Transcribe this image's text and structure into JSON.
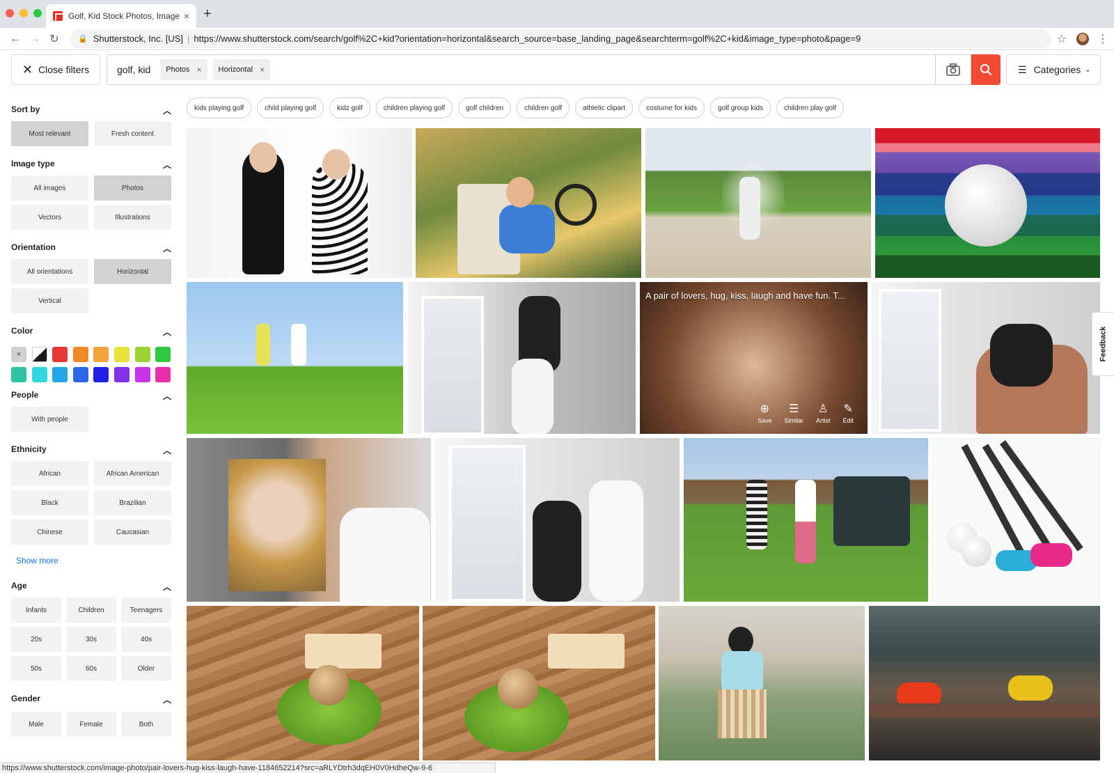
{
  "browser": {
    "tab_title": "Golf, Kid Stock Photos, Images",
    "tab_close": "×",
    "new_tab": "+",
    "org": "Shutterstock, Inc. [US]",
    "separator": "|",
    "url": "https://www.shutterstock.com/search/golf%2C+kid?orientation=horizontal&search_source=base_landing_page&searchterm=golf%2C+kid&image_type=photo&page=9",
    "status_url": "https://www.shutterstock.com/image-photo/pair-lovers-hug-kiss-laugh-have-1184652214?src=aRLYDtrh3dqEH0V0HdheQw-9-6"
  },
  "header": {
    "close_filters": "Close filters",
    "query": "golf, kid",
    "chips": [
      "Photos",
      "Horizontal"
    ],
    "chip_remove": "×",
    "categories": "Categories"
  },
  "sidebar": {
    "sort_by": {
      "title": "Sort by",
      "options": [
        "Most relevant",
        "Fresh content"
      ]
    },
    "image_type": {
      "title": "Image type",
      "options": [
        "All images",
        "Photos",
        "Vectors",
        "Illustrations"
      ]
    },
    "orientation": {
      "title": "Orientation",
      "options": [
        "All orientations",
        "Horizontal",
        "Vertical"
      ]
    },
    "color": {
      "title": "Color",
      "clear_symbol": "×",
      "swatches": [
        "#cfd0d2",
        "#1a1a1a",
        "#e53935",
        "#f08a24",
        "#f1a33c",
        "#eae03a",
        "#9ad333",
        "#2ec93e",
        "#2ec4a2",
        "#2fd7e0",
        "#23a5e8",
        "#2c67e8",
        "#1f1fe6",
        "#8232e6",
        "#c832e8",
        "#e82ea8"
      ]
    },
    "people": {
      "title": "People",
      "options": [
        "With people"
      ]
    },
    "ethnicity": {
      "title": "Ethnicity",
      "options": [
        "African",
        "African American",
        "Black",
        "Brazilian",
        "Chinese",
        "Caucasian"
      ],
      "show_more": "Show more"
    },
    "age": {
      "title": "Age",
      "options": [
        "Infants",
        "Children",
        "Teenagers",
        "20s",
        "30s",
        "40s",
        "50s",
        "60s",
        "Older"
      ]
    },
    "gender": {
      "title": "Gender",
      "options": [
        "Male",
        "Female",
        "Both"
      ]
    }
  },
  "related": [
    "kids playing golf",
    "child playing golf",
    "kidz golf",
    "children playing golf",
    "golf children",
    "children golf",
    "athletic clipart",
    "costume for kids",
    "golf group kids",
    "children play golf"
  ],
  "hover": {
    "caption": "A pair of lovers, hug, kiss, laugh and have fun. T...",
    "actions": [
      "Save",
      "Similar",
      "Artist",
      "Edit"
    ]
  },
  "feedback": "Feedback"
}
